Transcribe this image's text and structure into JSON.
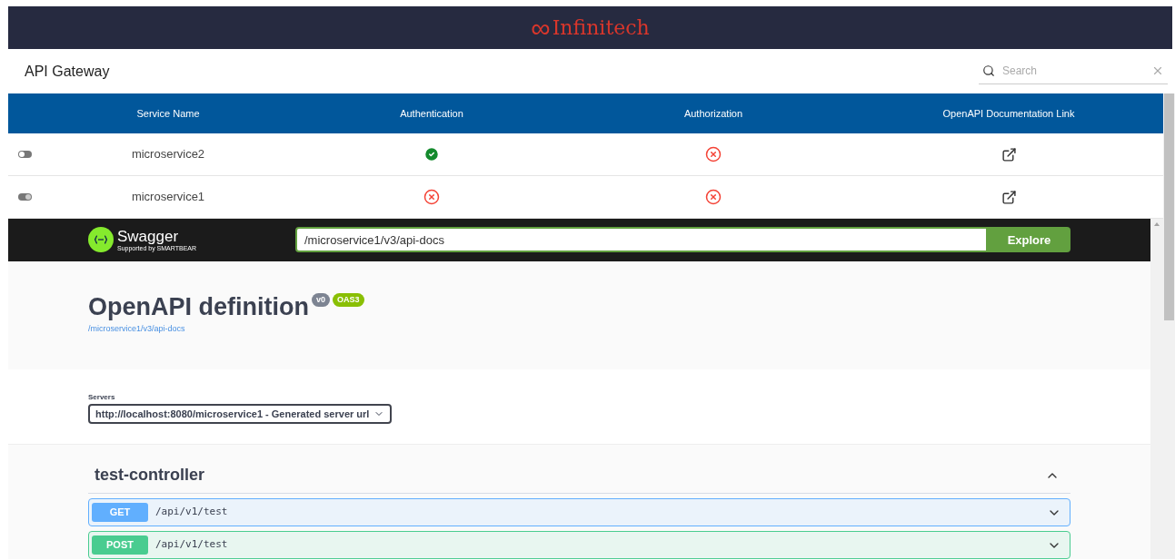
{
  "brand": {
    "logo": "∞",
    "name": "Infinitech"
  },
  "page_title": "API Gateway",
  "search": {
    "placeholder": "Search"
  },
  "table": {
    "columns": [
      "Service Name",
      "Authentication",
      "Authorization",
      "OpenAPI Documentation Link"
    ],
    "rows": [
      {
        "on": false,
        "name": "microservice2",
        "authentication": true,
        "authorization": false
      },
      {
        "on": true,
        "name": "microservice1",
        "authentication": false,
        "authorization": false
      }
    ]
  },
  "swagger": {
    "logo": "Swagger",
    "tagline": "Supported by SMARTBEAR",
    "url": "/microservice1/v3/api-docs",
    "explore": "Explore",
    "title": "OpenAPI definition",
    "version": "v0",
    "spec": "OAS3",
    "spec_link": "/microservice1/v3/api-docs",
    "servers_label": "Servers",
    "server": "http://localhost:8080/microservice1 - Generated server url",
    "section": {
      "name": "test-controller",
      "expanded": true,
      "operations": [
        {
          "kind": "get",
          "method": "GET",
          "path": "/api/v1/test"
        },
        {
          "kind": "post",
          "method": "POST",
          "path": "/api/v1/test"
        }
      ]
    }
  }
}
